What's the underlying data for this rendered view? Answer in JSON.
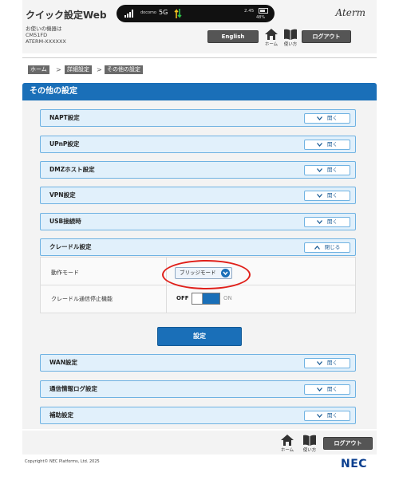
{
  "header": {
    "app_title": "クイック設定Web",
    "device_label": "お使いの機器は",
    "device_id": "CM51FD",
    "device_serial": "ATERM-XXXXXX",
    "brand": "Aterm",
    "english_label": "English",
    "home_label": "ホーム",
    "help_label": "使い方",
    "logout_label": "ログアウト"
  },
  "status_bar": {
    "carrier": "docomo",
    "network": "5G",
    "data_usage": "2.45",
    "battery": "48%",
    "icons": [
      "signal-icon",
      "updown-arrows-icon",
      "battery-icon"
    ]
  },
  "breadcrumb": {
    "items": [
      "ホーム",
      "詳細設定",
      "その他の設定"
    ],
    "separator": ">"
  },
  "section": {
    "title": "その他の設定"
  },
  "accordions": [
    {
      "label": "NAPT設定",
      "button": "開く"
    },
    {
      "label": "UPnP設定",
      "button": "開く"
    },
    {
      "label": "DMZホスト設定",
      "button": "開く"
    },
    {
      "label": "VPN設定",
      "button": "開く"
    },
    {
      "label": "USB接続時",
      "button": "開く"
    },
    {
      "label": "クレードル設定",
      "button": "閉じる"
    }
  ],
  "cradle": {
    "mode_label": "動作モード",
    "mode_value": "ブリッジモード",
    "stop_label": "クレードル通信停止機能",
    "toggle_off": "OFF",
    "toggle_on": "ON"
  },
  "set_button": "設定",
  "accordions_bottom": [
    {
      "label": "WAN設定",
      "button": "開く"
    },
    {
      "label": "通信情報ログ設定",
      "button": "開く"
    },
    {
      "label": "補助設定",
      "button": "開く"
    }
  ],
  "footer": {
    "home_label": "ホーム",
    "help_label": "使い方",
    "logout_label": "ログアウト",
    "copyright": "Copyright© NEC Platforms, Ltd. 2025",
    "logo": "NEC"
  },
  "colors": {
    "accent": "#1a6fb8",
    "row_bg": "#e1f0fb",
    "row_border": "#6fb2e2",
    "highlight": "#e0201a",
    "dark_button": "#555555"
  }
}
